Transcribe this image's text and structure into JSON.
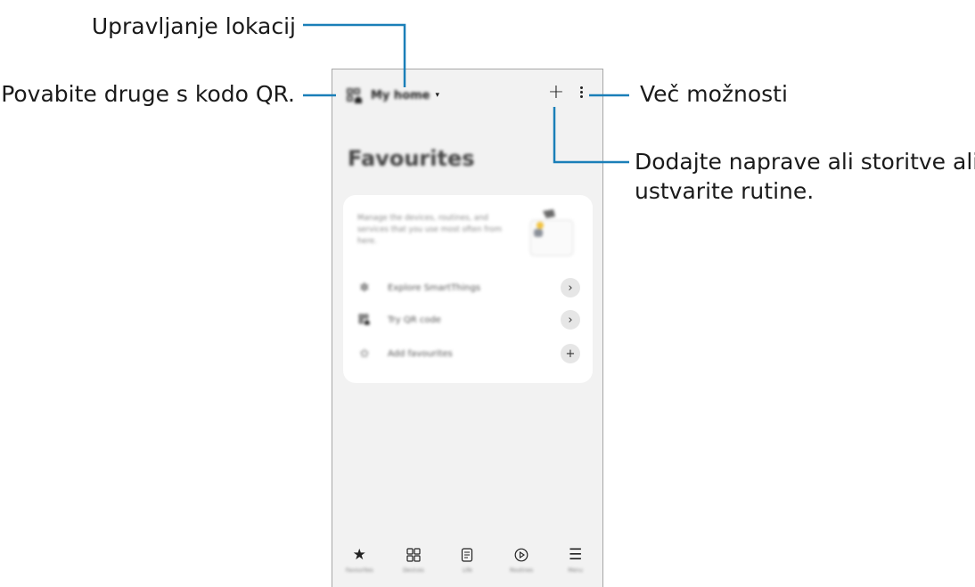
{
  "annotations": {
    "location": "Upravljanje lokacij",
    "invite": "Povabite druge s kodo QR.",
    "more": "Več možnosti",
    "add_line1": "Dodajte naprave ali storitve ali",
    "add_line2": "ustvarite rutine."
  },
  "colors": {
    "leader_line": "#1a7fb8",
    "screen_bg": "#f2f2f2",
    "card_bg": "#ffffff"
  },
  "topbar": {
    "location_name": "My home",
    "caret": "▾",
    "add_icon": "+",
    "qr_icon": "qr-home-icon",
    "more_icon": "vertical-dots-icon"
  },
  "page_title": "Favourites",
  "card": {
    "description": "Manage the devices, routines, and services that you use most often from here.",
    "rows": [
      {
        "label": "Explore SmartThings",
        "icon": "smartthings-icon",
        "action": "›"
      },
      {
        "label": "Try QR code",
        "icon": "qr-home-icon",
        "action": "›"
      },
      {
        "label": "Add favourites",
        "icon": "star-add-icon",
        "action": "+"
      }
    ]
  },
  "bottom_nav": [
    {
      "label": "Favourites",
      "icon": "star-icon",
      "glyph": "★"
    },
    {
      "label": "Devices",
      "icon": "grid-icon",
      "glyph": ""
    },
    {
      "label": "Life",
      "icon": "life-icon",
      "glyph": ""
    },
    {
      "label": "Routines",
      "icon": "play-circle-icon",
      "glyph": ""
    },
    {
      "label": "Menu",
      "icon": "menu-icon",
      "glyph": "☰"
    }
  ]
}
